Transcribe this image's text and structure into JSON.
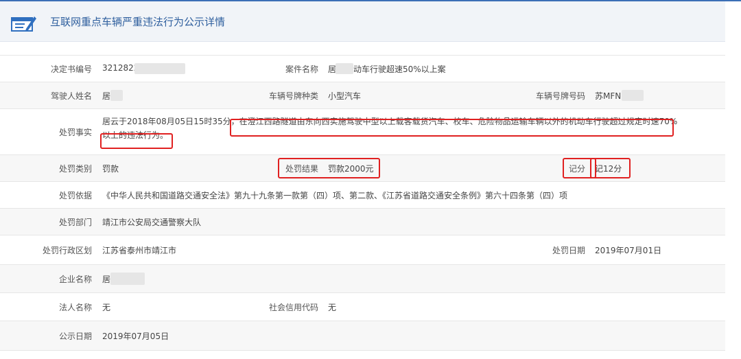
{
  "header": {
    "title": "互联网重点车辆严重违法行为公示详情"
  },
  "fields": {
    "decision_no_label": "决定书编号",
    "decision_no_value": "3212822",
    "case_name_label": "案件名称",
    "case_name_value_a": "居",
    "case_name_value_b": "动车行驶超速50%以上案",
    "driver_label": "驾驶人姓名",
    "driver_value": "居",
    "plate_type_label": "车辆号牌种类",
    "plate_type_value": "小型汽车",
    "plate_no_label": "车辆号牌号码",
    "plate_no_value": "苏MFN",
    "fact_label": "处罚事实",
    "fact_line1_a": "居云于2018年08月05日15时35分，",
    "fact_line1_b": "在澄江西路隧道由东向西实施驾驶中型以上载客载货汽车、校车、危险物品运输车辆以外的机动车行驶超过规定时速70%",
    "fact_line2": "以上的违法行为。",
    "category_label": "处罚类别",
    "category_value": "罚款",
    "result_label": "处罚结果",
    "result_value": "罚款2000元",
    "points_label": "记分",
    "points_value": "记12分",
    "basis_label": "处罚依据",
    "basis_value": "《中华人民共和国道路交通安全法》第九十九条第一款第（四）项、第二款、《江苏省道路交通安全条例》第六十四条第（四）项",
    "dept_label": "处罚部门",
    "dept_value": "靖江市公安局交通警察大队",
    "region_label": "处罚行政区划",
    "region_value": "江苏省泰州市靖江市",
    "date_label": "处罚日期",
    "date_value": "2019年07月01日",
    "company_label": "企业名称",
    "company_value": "居",
    "legal_label": "法人名称",
    "legal_value": "无",
    "credit_label": "社会信用代码",
    "credit_value": "无",
    "publish_label": "公示日期",
    "publish_value": "2019年07月05日"
  },
  "colors": {
    "accent": "#2f5f9e",
    "highlight": "#e02020"
  }
}
